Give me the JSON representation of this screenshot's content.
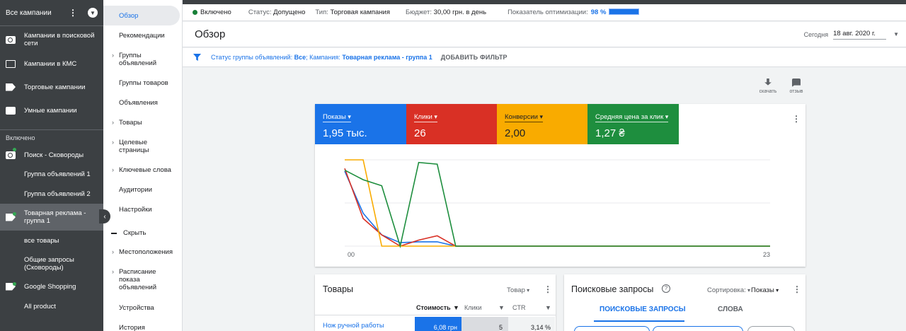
{
  "leftnav": {
    "title": "Все кампании",
    "items": [
      {
        "label": "Кампании в поисковой сети",
        "icon": "search-icon"
      },
      {
        "label": "Кампании в КМС",
        "icon": "display-icon"
      },
      {
        "label": "Торговые кампании",
        "icon": "shopping-tag-icon"
      },
      {
        "label": "Умные кампании",
        "icon": "smart-wand-icon"
      }
    ],
    "section_label": "Включено",
    "campaign_search": "Поиск - Сковороды",
    "adgroup_1": "Группа объявлений 1",
    "adgroup_2": "Группа объявлений 2",
    "campaign_product": "Товарная реклама - группа 1",
    "all_products": "все товары",
    "general_queries": "Общие запросы (Сковороды)",
    "google_shopping": "Google Shopping",
    "all_product": "All product"
  },
  "secnav": {
    "items": [
      {
        "label": "Обзор"
      },
      {
        "label": "Рекомендации"
      },
      {
        "label": "Группы объявлений"
      },
      {
        "label": "Группы товаров"
      },
      {
        "label": "Объявления"
      },
      {
        "label": "Товары"
      },
      {
        "label": "Целевые страницы"
      },
      {
        "label": "Ключевые слова"
      },
      {
        "label": "Аудитории"
      },
      {
        "label": "Настройки"
      },
      {
        "label": "Скрыть"
      },
      {
        "label": "Местоположения"
      },
      {
        "label": "Расписание показа объявлений"
      },
      {
        "label": "Устройства"
      },
      {
        "label": "История"
      }
    ]
  },
  "statusbar": {
    "enabled": "Включено",
    "status_label": "Статус:",
    "status_value": "Допущено",
    "type_label": "Тип:",
    "type_value": "Торговая кампания",
    "budget_label": "Бюджет:",
    "budget_value": "30,00 грн. в день",
    "opt_label": "Показатель оптимизации:",
    "opt_value": "98 %"
  },
  "header": {
    "title": "Обзор",
    "date_label": "Сегодня",
    "date_value": "18 авг. 2020 г."
  },
  "filter": {
    "status_label": "Статус группы объявлений:",
    "status_value": "Все",
    "campaign_label": "; Кампания:",
    "campaign_value": "Товарная реклама - группа 1",
    "add_filter": "ДОБАВИТЬ ФИЛЬТР"
  },
  "tools": {
    "download": "скачать",
    "feedback": "отзыв"
  },
  "metrics": [
    {
      "label": "Показы",
      "value": "1,95 тыс.",
      "color": "#1a73e8"
    },
    {
      "label": "Клики",
      "value": "26",
      "color": "#d93025"
    },
    {
      "label": "Конверсии",
      "value": "2,00",
      "color": "#f9ab00"
    },
    {
      "label": "Средняя цена за клик",
      "value": "1,27 ₴",
      "color": "#1e8e3e"
    }
  ],
  "chart_data": {
    "type": "line",
    "x": [
      0,
      1,
      2,
      3,
      4,
      5,
      6,
      7,
      8,
      9,
      10,
      11,
      12,
      13,
      14,
      15,
      16,
      17,
      18,
      19,
      20,
      21,
      22,
      23
    ],
    "tick_labels": [
      "00",
      "23"
    ],
    "ylim": [
      0,
      1
    ],
    "grid": true,
    "series": [
      {
        "color": "#1a73e8",
        "values": [
          0.87,
          0.38,
          0.13,
          0.04,
          0.05,
          0.05,
          0,
          0,
          0,
          0,
          0,
          0,
          0,
          0,
          0,
          0,
          0,
          0,
          0,
          0,
          0,
          0,
          0,
          0
        ]
      },
      {
        "color": "#d93025",
        "values": [
          0.9,
          0.32,
          0.13,
          0.0,
          0.07,
          0.12,
          0,
          0,
          0,
          0,
          0,
          0,
          0,
          0,
          0,
          0,
          0,
          0,
          0,
          0,
          0,
          0,
          0,
          0
        ]
      },
      {
        "color": "#f9ab00",
        "values": [
          1.0,
          1.0,
          0.0,
          0.0,
          0.0,
          0.0,
          0,
          0,
          0,
          0,
          0,
          0,
          0,
          0,
          0,
          0,
          0,
          0,
          0,
          0,
          0,
          0,
          0,
          0
        ]
      },
      {
        "color": "#1e8e3e",
        "values": [
          0.88,
          0.77,
          0.7,
          0.0,
          0.97,
          0.95,
          0,
          0,
          0,
          0,
          0,
          0,
          0,
          0,
          0,
          0,
          0,
          0,
          0,
          0,
          0,
          0,
          0,
          0
        ]
      }
    ]
  },
  "products_card": {
    "title": "Товары",
    "selector": "Товар",
    "col_cost": "Стоимость",
    "col_clicks": "Клики",
    "col_ctr": "CTR",
    "row1_name": "Нож ручной работы",
    "row1_cost": "6,08 грн",
    "row1_clicks": "5",
    "row1_ctr": "3,14 %"
  },
  "queries_card": {
    "title": "Поисковые запросы",
    "sort_label": "Сортировка:",
    "sort_value": "Показы",
    "tab_queries": "ПОИСКОВЫЕ ЗАПРОСЫ",
    "tab_words": "СЛОВА"
  }
}
